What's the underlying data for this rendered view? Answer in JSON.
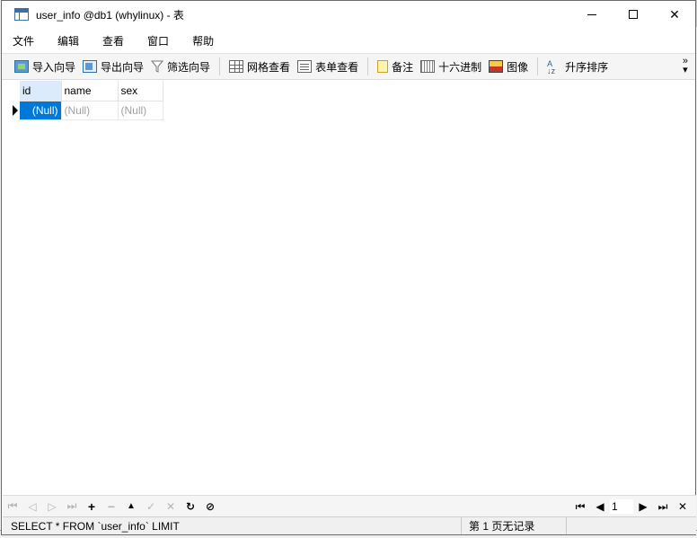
{
  "window": {
    "title": "user_info @db1 (whylinux) - 表"
  },
  "menu": [
    "文件",
    "编辑",
    "查看",
    "窗口",
    "帮助"
  ],
  "toolbar": {
    "import_wizard": "导入向导",
    "export_wizard": "导出向导",
    "filter_wizard": "筛选向导",
    "grid_view": "网格查看",
    "form_view": "表单查看",
    "memo": "备注",
    "hex": "十六进制",
    "image": "图像",
    "sort_asc": "升序排序"
  },
  "table": {
    "columns": [
      "id",
      "name",
      "sex"
    ],
    "rows": [
      [
        "(Null)",
        "(Null)",
        "(Null)"
      ]
    ]
  },
  "nav": {
    "page_value": "1"
  },
  "status": {
    "sql": "SELECT * FROM `user_info` LIMIT",
    "page_info": "第 1 页无记录"
  }
}
